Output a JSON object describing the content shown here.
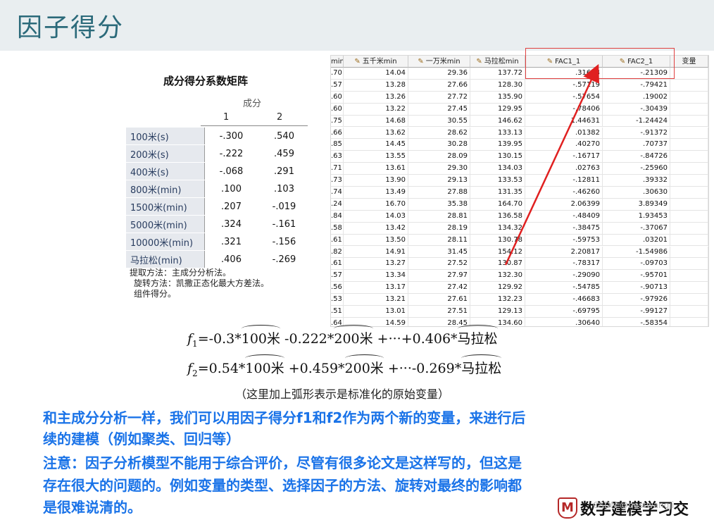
{
  "title": "因子得分",
  "matrix": {
    "title": "成分得分系数矩阵",
    "component_caption": "成分",
    "component_headers": [
      "1",
      "2"
    ],
    "rows": [
      {
        "label": "100米(s)",
        "c1": "-.300",
        "c2": ".540"
      },
      {
        "label": "200米(s)",
        "c1": "-.222",
        "c2": ".459"
      },
      {
        "label": "400米(s)",
        "c1": "-.068",
        "c2": ".291"
      },
      {
        "label": "800米(min)",
        "c1": ".100",
        "c2": ".103"
      },
      {
        "label": "1500米(min)",
        "c1": ".207",
        "c2": "-.019"
      },
      {
        "label": "5000米(min)",
        "c1": ".324",
        "c2": "-.161"
      },
      {
        "label": "10000米(min)",
        "c1": ".321",
        "c2": "-.156"
      },
      {
        "label": "马拉松(min)",
        "c1": ".406",
        "c2": "-.269"
      }
    ],
    "notes": [
      "提取方法：主成分分析法。",
      "旋转方法：凯撒正态化最大方差法。",
      "组件得分。"
    ]
  },
  "grid": {
    "headers": [
      "min",
      "五千米min",
      "一万米min",
      "马拉松min",
      "FAC1_1",
      "FAC2_1",
      "变量"
    ],
    "rows": [
      [
        ".70",
        "14.04",
        "29.36",
        "137.72",
        ".31698",
        "-.21309"
      ],
      [
        ".57",
        "13.28",
        "27.66",
        "128.30",
        "-.57119",
        "-.79421"
      ],
      [
        ".60",
        "13.26",
        "27.72",
        "135.90",
        "-.57654",
        ".19002"
      ],
      [
        ".60",
        "13.22",
        "27.45",
        "129.95",
        "-.78406",
        "-.30439"
      ],
      [
        ".75",
        "14.68",
        "30.55",
        "146.62",
        "1.44631",
        "-1.24424"
      ],
      [
        ".66",
        "13.62",
        "28.62",
        "133.13",
        ".01382",
        "-.91372"
      ],
      [
        ".85",
        "14.45",
        "30.28",
        "139.95",
        ".40270",
        ".70737"
      ],
      [
        ".63",
        "13.55",
        "28.09",
        "130.15",
        "-.16717",
        "-.84726"
      ],
      [
        ".71",
        "13.61",
        "29.30",
        "134.03",
        ".02763",
        "-.25960"
      ],
      [
        ".73",
        "13.90",
        "29.13",
        "133.53",
        "-.12811",
        ".39332"
      ],
      [
        ".74",
        "13.49",
        "27.88",
        "131.35",
        "-.46260",
        ".30630"
      ],
      [
        ".24",
        "16.70",
        "35.38",
        "164.70",
        "2.06399",
        "3.89349"
      ],
      [
        ".84",
        "14.03",
        "28.81",
        "136.58",
        "-.48409",
        "1.93453"
      ],
      [
        ".58",
        "13.42",
        "28.19",
        "134.32",
        "-.38475",
        "-.37067"
      ],
      [
        ".61",
        "13.50",
        "28.11",
        "130.78",
        "-.59753",
        ".03201"
      ],
      [
        ".82",
        "14.91",
        "31.45",
        "154.12",
        "2.20817",
        "-1.54986"
      ],
      [
        ".61",
        "13.27",
        "27.52",
        "130.87",
        "-.78317",
        "-.09703"
      ],
      [
        ".57",
        "13.34",
        "27.97",
        "132.30",
        "-.29090",
        "-.95701"
      ],
      [
        ".56",
        "13.17",
        "27.42",
        "129.92",
        "-.54785",
        "-.90713"
      ],
      [
        ".53",
        "13.21",
        "27.61",
        "132.23",
        "-.46683",
        "-.97926"
      ],
      [
        ".51",
        "13.01",
        "27.51",
        "129.13",
        "-.69795",
        "-.99127"
      ],
      [
        ".64",
        "14.59",
        "28.45",
        "134.60",
        ".30640",
        "-.58354"
      ]
    ]
  },
  "formula1": {
    "lhs": "f",
    "sub": "1",
    "eq": "=-0.3*",
    "t1": "100米",
    "mid1": " -0.222*",
    "t2": "200米",
    "mid2": " +···+0.406*",
    "t3": "马拉松"
  },
  "formula2": {
    "lhs": "f",
    "sub": "2",
    "eq": "=0.54*",
    "t1": "100米",
    "mid1": " +0.459*",
    "t2": "200米",
    "mid2": " +···-0.269*",
    "t3": "马拉松"
  },
  "caption": "（这里加上弧形表示是标准化的原始变量）",
  "para_lines": [
    "和主成分分析一样，我们可以用因子得分f1和f2作为两个新的变量，来进行后",
    "续的建模（例如聚类、回归等）",
    "注意：因子分析模型不能用于综合评价，尽管有很多论文是这样写的，但这是",
    "存在很大的问题的。例如变量的类型、选择因子的方法、旋转对最终的影响都",
    "是很难说清的。"
  ],
  "logo_text": "数学建模学习交",
  "logo_mark": "M",
  "watermark": "CSDN @bestwangji"
}
